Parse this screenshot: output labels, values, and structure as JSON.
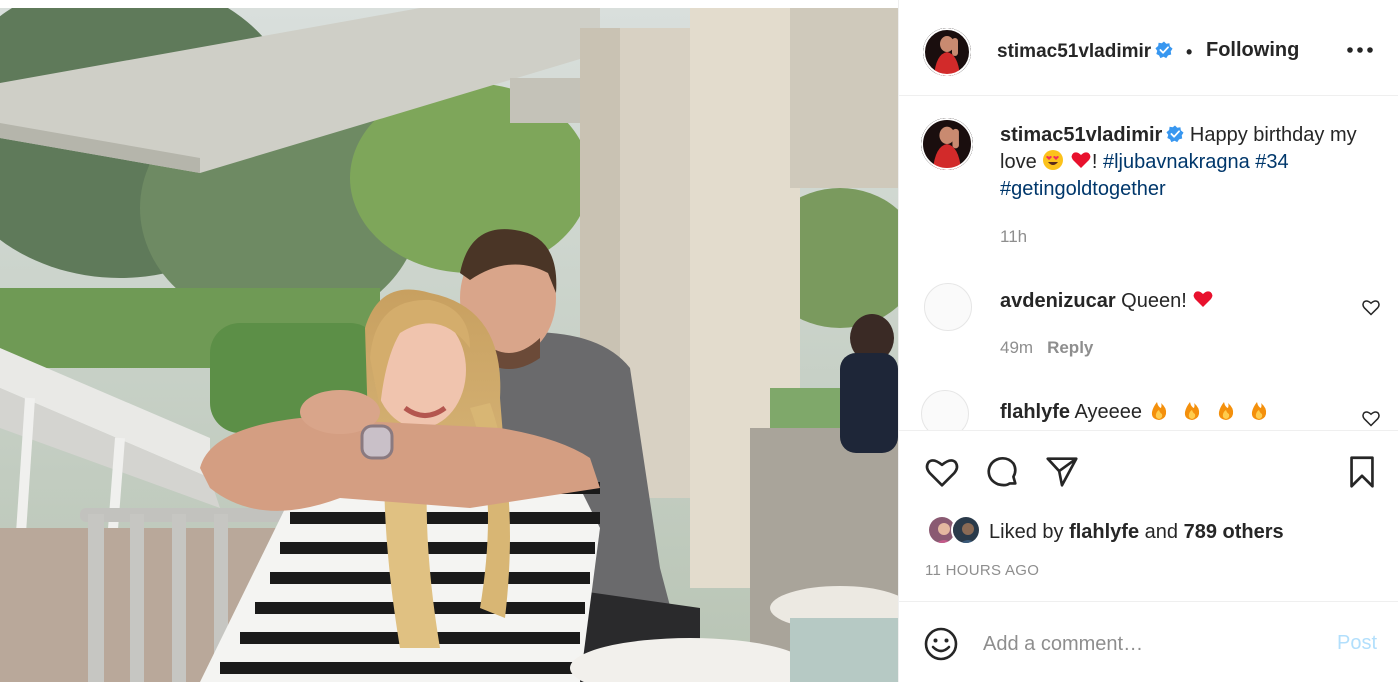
{
  "post": {
    "username": "stimac51vladimir",
    "verified": true,
    "follow_status": "Following",
    "caption": {
      "text": "Happy birthday my love",
      "emojis": [
        "heart-eyes-emoji",
        "red-heart-emoji"
      ],
      "after_emoji": "!",
      "hashtags": [
        "#ljubavnakragna",
        "#34",
        "#getingoldtogether"
      ]
    },
    "caption_time": "11h"
  },
  "comments": [
    {
      "username": "avdenizucar",
      "text": "Queen!",
      "emoji": "red-heart-emoji",
      "time": "49m",
      "reply_label": "Reply"
    },
    {
      "username": "flahlyfe",
      "text": "Ayeeee",
      "emoji": "fire-emoji x4"
    }
  ],
  "actions": {
    "like_icon": "heart-icon",
    "comment_icon": "comment-icon",
    "share_icon": "paper-plane-icon",
    "save_icon": "bookmark-icon"
  },
  "likes": {
    "prefix": "Liked by",
    "first_user": "flahlyfe",
    "and": "and",
    "others": "789 others"
  },
  "timestamp": "11 HOURS AGO",
  "add_comment": {
    "placeholder": "Add a comment…",
    "post_label": "Post"
  },
  "colors": {
    "verified": "#3897f0",
    "link": "#00376b",
    "muted": "#8e8e8e",
    "post_disabled": "#b2dffc",
    "heart": "#ed4956"
  }
}
